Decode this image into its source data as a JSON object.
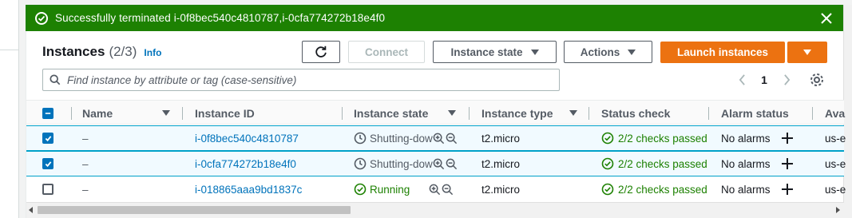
{
  "flash": {
    "message": "Successfully terminated i-0f8bec540c4810787,i-0cfa774272b18e4f0"
  },
  "header": {
    "title": "Instances",
    "count": "(2/3)",
    "info": "Info"
  },
  "toolbar": {
    "connect": "Connect",
    "instance_state": "Instance state",
    "actions": "Actions",
    "launch": "Launch instances"
  },
  "search": {
    "placeholder": "Find instance by attribute or tag (case-sensitive)"
  },
  "pagination": {
    "page": "1"
  },
  "table": {
    "columns": [
      "Name",
      "Instance ID",
      "Instance state",
      "Instance type",
      "Status check",
      "Alarm status",
      "Ava"
    ],
    "rows": [
      {
        "name": "–",
        "instance_id": "i-0f8bec540c4810787",
        "state": "Shutting-dow",
        "type": "t2.micro",
        "status_check": "2/2 checks passed",
        "alarm": "No alarms",
        "az": "us-e"
      },
      {
        "name": "–",
        "instance_id": "i-0cfa774272b18e4f0",
        "state": "Shutting-dow",
        "type": "t2.micro",
        "status_check": "2/2 checks passed",
        "alarm": "No alarms",
        "az": "us-e"
      },
      {
        "name": "–",
        "instance_id": "i-018865aaa9bd1837c",
        "state": "Running",
        "type": "t2.micro",
        "status_check": "2/2 checks passed",
        "alarm": "No alarms",
        "az": "us-e"
      }
    ]
  },
  "colors": {
    "success": "#1d8102",
    "primary": "#ec7211",
    "link": "#0073bb"
  }
}
